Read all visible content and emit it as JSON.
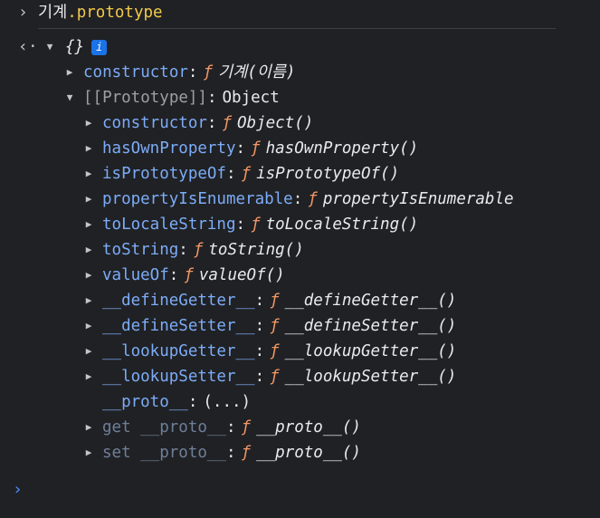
{
  "input": {
    "command_object": "기계",
    "command_property": ".prototype"
  },
  "result": {
    "summary": "{}",
    "info_badge": "i"
  },
  "rows": {
    "constructor_outer_key": "constructor",
    "constructor_outer_fn": "기계(이름)",
    "prototype_key": "[[Prototype]]",
    "prototype_val": "Object",
    "p1_key": "constructor",
    "p1_fn": "Object()",
    "p2_key": "hasOwnProperty",
    "p2_fn": "hasOwnProperty()",
    "p3_key": "isPrototypeOf",
    "p3_fn": "isPrototypeOf()",
    "p4_key": "propertyIsEnumerable",
    "p4_fn": "propertyIsEnumerable",
    "p5_key": "toLocaleString",
    "p5_fn": "toLocaleString()",
    "p6_key": "toString",
    "p6_fn": "toString()",
    "p7_key": "valueOf",
    "p7_fn": "valueOf()",
    "p8_key": "__defineGetter__",
    "p8_fn": "__defineGetter__()",
    "p9_key": "__defineSetter__",
    "p9_fn": "__defineSetter__()",
    "p10_key": "__lookupGetter__",
    "p10_fn": "__lookupGetter__()",
    "p11_key": "__lookupSetter__",
    "p11_fn": "__lookupSetter__()",
    "proto_key": "__proto__",
    "proto_val": "(...)",
    "getter_key": "get __proto__",
    "getter_fn": "__proto__()",
    "setter_key": "set __proto__",
    "setter_fn": "__proto__()"
  },
  "labels": {
    "f_symbol": "ƒ",
    "colon": ":"
  },
  "icons": {
    "input_prompt": "chevron-right-icon",
    "result_prompt": "return-arrow-icon",
    "new_prompt": "chevron-right-icon"
  },
  "colors": {
    "background": "#202124",
    "key": "#7cacf8",
    "key_dim": "#6f7f99",
    "function_marker": "#f29766",
    "prompt_blue": "#4d90fe"
  }
}
